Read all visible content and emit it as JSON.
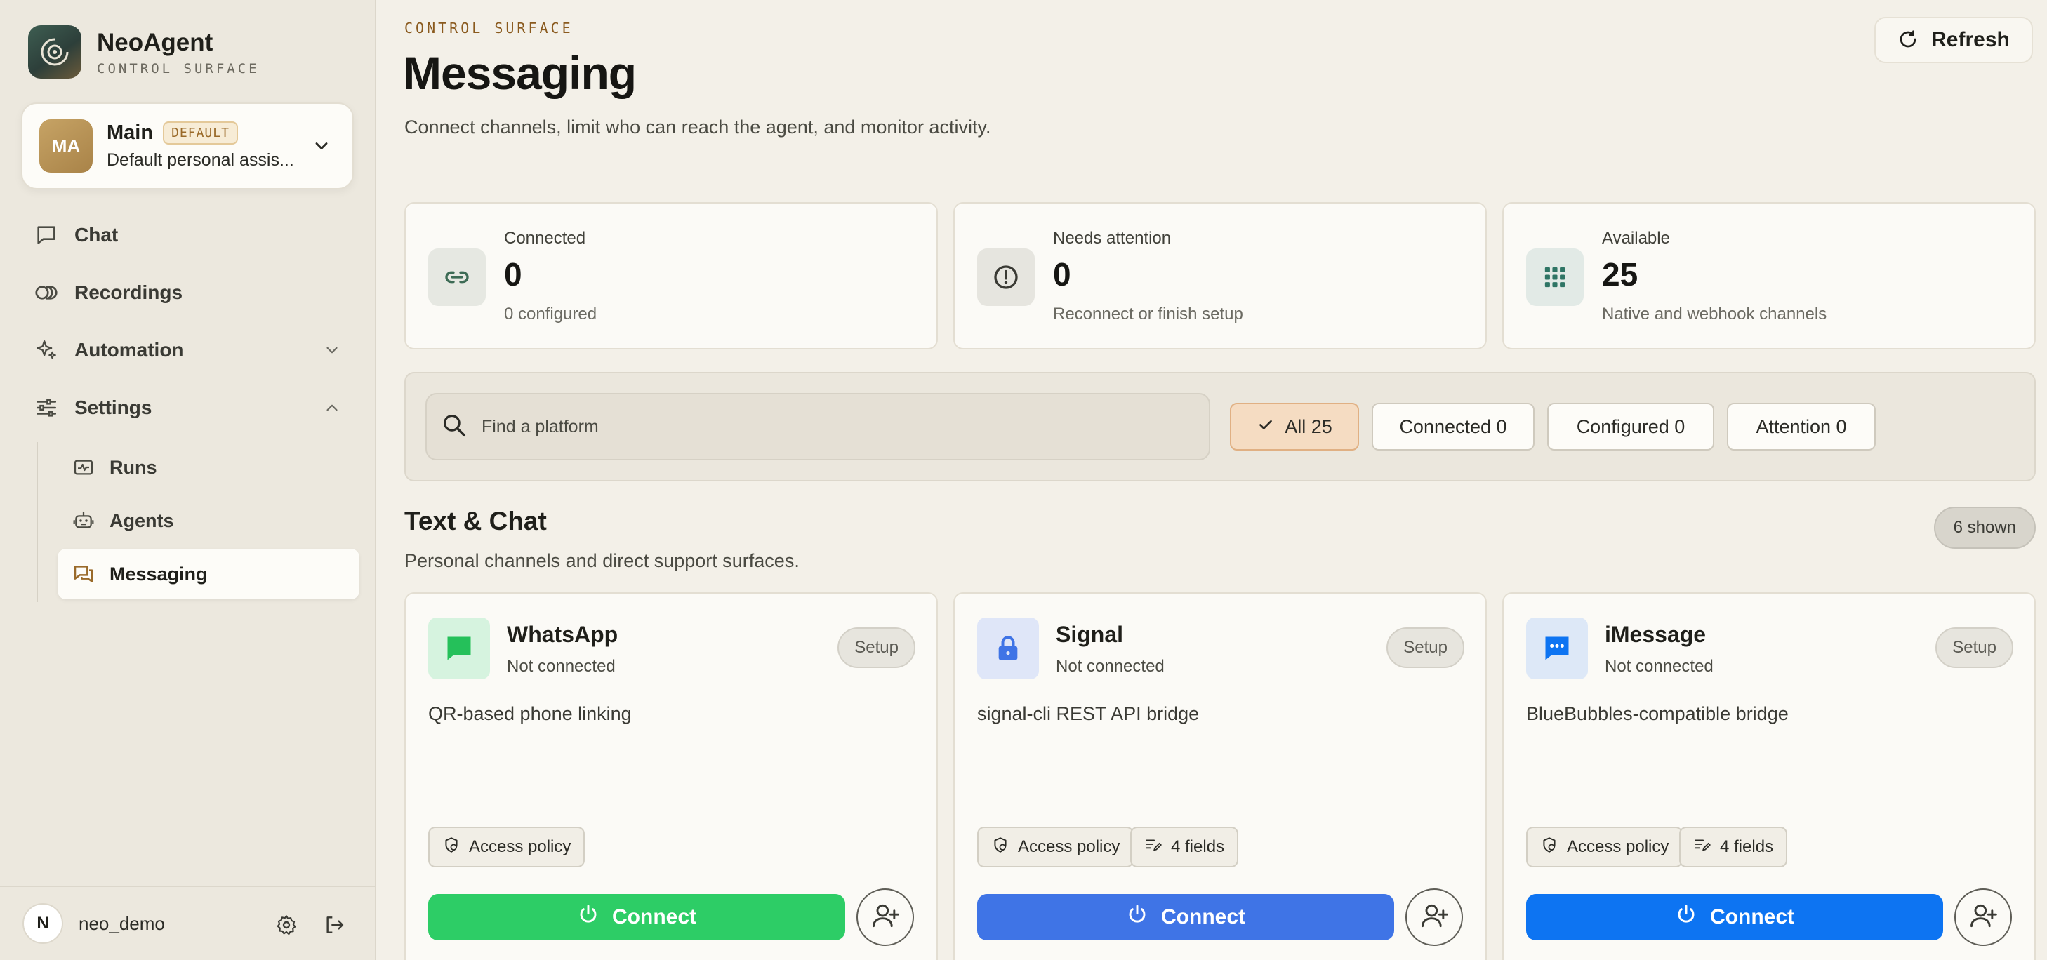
{
  "brand": {
    "name": "NeoAgent",
    "subtitle": "CONTROL SURFACE"
  },
  "agent": {
    "initials": "MA",
    "name": "Main",
    "badge": "DEFAULT",
    "description": "Default personal assis..."
  },
  "nav": {
    "items": [
      {
        "label": "Chat",
        "icon": "chat-bubble-icon"
      },
      {
        "label": "Recordings",
        "icon": "recordings-icon"
      },
      {
        "label": "Automation",
        "icon": "sparkle-icon",
        "expanded": false
      },
      {
        "label": "Settings",
        "icon": "sliders-icon",
        "expanded": true
      }
    ],
    "sub_items": [
      {
        "label": "Runs",
        "icon": "activity-icon"
      },
      {
        "label": "Agents",
        "icon": "robot-icon"
      },
      {
        "label": "Messaging",
        "icon": "messages-icon",
        "active": true
      }
    ]
  },
  "user": {
    "initial": "N",
    "name": "neo_demo"
  },
  "header": {
    "eyebrow": "CONTROL SURFACE",
    "title": "Messaging",
    "subtitle": "Connect channels, limit who can reach the agent, and monitor activity.",
    "refresh_label": "Refresh"
  },
  "stats": [
    {
      "label": "Connected",
      "value": "0",
      "note": "0 configured",
      "icon": "link-icon"
    },
    {
      "label": "Needs attention",
      "value": "0",
      "note": "Reconnect or finish setup",
      "icon": "alert-circle-icon"
    },
    {
      "label": "Available",
      "value": "25",
      "note": "Native and webhook channels",
      "icon": "grid-icon"
    }
  ],
  "filters": {
    "search_placeholder": "Find a platform",
    "chips": [
      {
        "label": "All 25",
        "active": true
      },
      {
        "label": "Connected 0",
        "active": false
      },
      {
        "label": "Configured 0",
        "active": false
      },
      {
        "label": "Attention 0",
        "active": false
      }
    ]
  },
  "section": {
    "title": "Text & Chat",
    "subtitle": "Personal channels and direct support surfaces.",
    "shown": "6 shown"
  },
  "cards": [
    {
      "name": "WhatsApp",
      "status": "Not connected",
      "setup": "Setup",
      "description": "QR-based phone linking",
      "access": "Access policy",
      "fields": "",
      "connect": "Connect",
      "color": "#2dcd66",
      "icon": "whatsapp-icon"
    },
    {
      "name": "Signal",
      "status": "Not connected",
      "setup": "Setup",
      "description": "signal-cli REST API bridge",
      "access": "Access policy",
      "fields": "4 fields",
      "connect": "Connect",
      "color": "#3f74e6",
      "icon": "lock-icon"
    },
    {
      "name": "iMessage",
      "status": "Not connected",
      "setup": "Setup",
      "description": "BlueBubbles-compatible bridge",
      "access": "Access policy",
      "fields": "4 fields",
      "connect": "Connect",
      "color": "#0d74f2",
      "icon": "imessage-icon"
    }
  ],
  "colors": {
    "accent": "#8a5a1e",
    "background": "#f3f0e8",
    "sidebar": "#ece8de"
  }
}
